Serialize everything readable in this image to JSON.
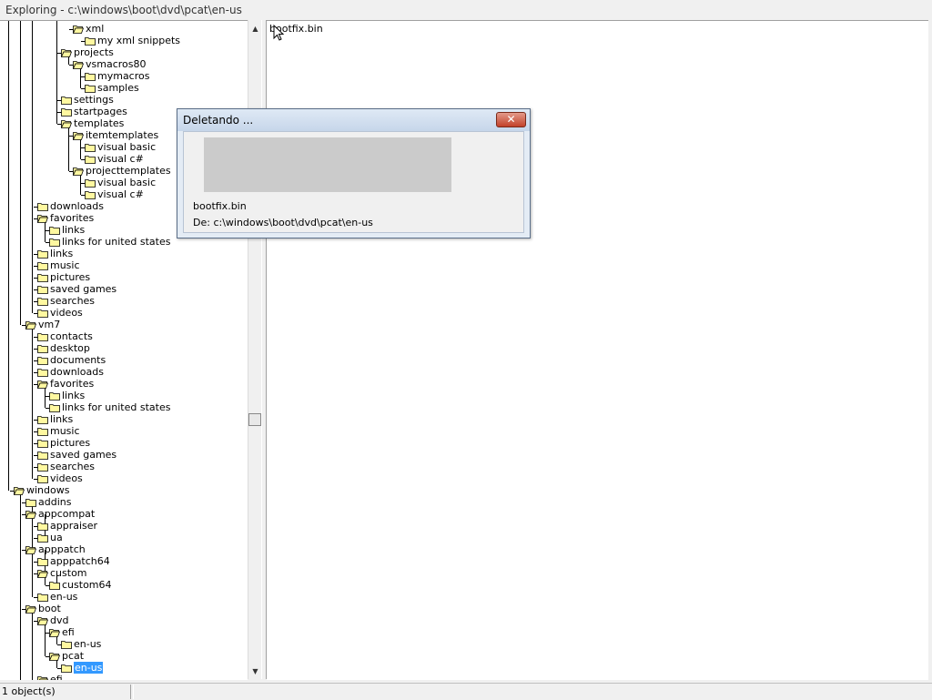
{
  "window": {
    "title": "Exploring - c:\\windows\\boot\\dvd\\pcat\\en-us"
  },
  "tree": {
    "items": [
      {
        "label": "xml",
        "open": true
      },
      {
        "label": "my xml snippets",
        "open": false
      },
      {
        "label": "projects",
        "open": true
      },
      {
        "label": "vsmacros80",
        "open": true
      },
      {
        "label": "mymacros",
        "open": false
      },
      {
        "label": "samples",
        "open": false
      },
      {
        "label": "settings",
        "open": false
      },
      {
        "label": "startpages",
        "open": false
      },
      {
        "label": "templates",
        "open": true
      },
      {
        "label": "itemtemplates",
        "open": true
      },
      {
        "label": "visual basic",
        "open": false
      },
      {
        "label": "visual c#",
        "open": false
      },
      {
        "label": "projecttemplates",
        "open": true
      },
      {
        "label": "visual basic",
        "open": false
      },
      {
        "label": "visual c#",
        "open": false
      },
      {
        "label": "downloads",
        "open": false
      },
      {
        "label": "favorites",
        "open": true
      },
      {
        "label": "links",
        "open": false
      },
      {
        "label": "links for united states",
        "open": false
      },
      {
        "label": "links",
        "open": false
      },
      {
        "label": "music",
        "open": false
      },
      {
        "label": "pictures",
        "open": false
      },
      {
        "label": "saved games",
        "open": false
      },
      {
        "label": "searches",
        "open": false
      },
      {
        "label": "videos",
        "open": false
      },
      {
        "label": "vm7",
        "open": true
      },
      {
        "label": "contacts",
        "open": false
      },
      {
        "label": "desktop",
        "open": false
      },
      {
        "label": "documents",
        "open": false
      },
      {
        "label": "downloads",
        "open": false
      },
      {
        "label": "favorites",
        "open": true
      },
      {
        "label": "links",
        "open": false
      },
      {
        "label": "links for united states",
        "open": false
      },
      {
        "label": "links",
        "open": false
      },
      {
        "label": "music",
        "open": false
      },
      {
        "label": "pictures",
        "open": false
      },
      {
        "label": "saved games",
        "open": false
      },
      {
        "label": "searches",
        "open": false
      },
      {
        "label": "videos",
        "open": false
      },
      {
        "label": "windows",
        "open": true
      },
      {
        "label": "addins",
        "open": false
      },
      {
        "label": "appcompat",
        "open": true
      },
      {
        "label": "appraiser",
        "open": false
      },
      {
        "label": "ua",
        "open": false
      },
      {
        "label": "apppatch",
        "open": true
      },
      {
        "label": "apppatch64",
        "open": false
      },
      {
        "label": "custom",
        "open": true
      },
      {
        "label": "custom64",
        "open": false
      },
      {
        "label": "en-us",
        "open": false
      },
      {
        "label": "boot",
        "open": true
      },
      {
        "label": "dvd",
        "open": true
      },
      {
        "label": "efi",
        "open": true
      },
      {
        "label": "en-us",
        "open": false
      },
      {
        "label": "pcat",
        "open": true
      },
      {
        "label": "en-us",
        "open": false,
        "selected": true
      },
      {
        "label": "efi",
        "open": true
      }
    ]
  },
  "files": {
    "items": [
      "bootfix.bin"
    ]
  },
  "status": {
    "objects": "1 object(s)"
  },
  "dialog": {
    "title": "Deletando ...",
    "close_label": "✕",
    "file": "bootfix.bin",
    "from": "De: c:\\windows\\boot\\dvd\\pcat\\en-us"
  }
}
